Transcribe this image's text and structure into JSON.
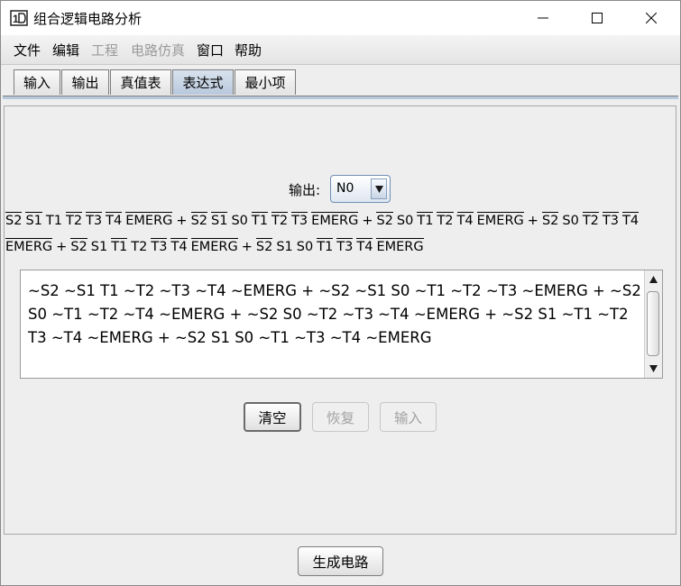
{
  "window": {
    "title": "组合逻辑电路分析"
  },
  "menu": [
    {
      "label": "文件",
      "enabled": true
    },
    {
      "label": "编辑",
      "enabled": true
    },
    {
      "label": "工程",
      "enabled": false
    },
    {
      "label": "电路仿真",
      "enabled": false
    },
    {
      "label": "窗口",
      "enabled": true
    },
    {
      "label": "帮助",
      "enabled": true
    }
  ],
  "tabs": [
    {
      "label": "输入",
      "active": false
    },
    {
      "label": "输出",
      "active": false
    },
    {
      "label": "真值表",
      "active": false
    },
    {
      "label": "表达式",
      "active": true
    },
    {
      "label": "最小项",
      "active": false
    }
  ],
  "output": {
    "label": "输出:",
    "selected": "N0"
  },
  "expression_lines": [
    [
      {
        "t": "S2",
        "n": true
      },
      {
        "t": "S1",
        "n": true
      },
      {
        "t": "T1",
        "n": false
      },
      {
        "t": "T2",
        "n": true
      },
      {
        "t": "T3",
        "n": true
      },
      {
        "t": "T4",
        "n": true
      },
      {
        "t": "EMERG",
        "n": true
      },
      {
        "t": "+",
        "n": false
      },
      {
        "t": "S2",
        "n": true
      },
      {
        "t": "S1",
        "n": true
      },
      {
        "t": "S0",
        "n": false
      },
      {
        "t": "T1",
        "n": true
      },
      {
        "t": "T2",
        "n": true
      },
      {
        "t": "T3",
        "n": true
      },
      {
        "t": "EMERG",
        "n": true
      },
      {
        "t": "+",
        "n": false
      },
      {
        "t": "S2",
        "n": true
      },
      {
        "t": "S0",
        "n": false
      },
      {
        "t": "T1",
        "n": true
      },
      {
        "t": "T2",
        "n": true
      },
      {
        "t": "T4",
        "n": true
      },
      {
        "t": "EMERG",
        "n": true
      },
      {
        "t": "+",
        "n": false
      },
      {
        "t": "S2",
        "n": true
      },
      {
        "t": "S0",
        "n": false
      },
      {
        "t": "T2",
        "n": true
      },
      {
        "t": "T3",
        "n": true
      },
      {
        "t": "T4",
        "n": true
      }
    ],
    [
      {
        "t": "EMERG",
        "n": true
      },
      {
        "t": "+",
        "n": false
      },
      {
        "t": "S2",
        "n": true
      },
      {
        "t": "S1",
        "n": false
      },
      {
        "t": "T1",
        "n": true
      },
      {
        "t": "T2",
        "n": false
      },
      {
        "t": "T3",
        "n": true
      },
      {
        "t": "T4",
        "n": true
      },
      {
        "t": "EMERG",
        "n": true
      },
      {
        "t": "+",
        "n": false
      },
      {
        "t": "S2",
        "n": true
      },
      {
        "t": "S1",
        "n": false
      },
      {
        "t": "S0",
        "n": false
      },
      {
        "t": "T1",
        "n": true
      },
      {
        "t": "T3",
        "n": true
      },
      {
        "t": "T4",
        "n": true
      },
      {
        "t": "EMERG",
        "n": true
      }
    ]
  ],
  "editor_lines": [
    "~S2 ~S1 T1 ~T2 ~T3 ~T4 ~EMERG + ~S2 ~S1 S0 ~T1 ~T2 ~T3 ~EMERG + ~S2",
    "S0 ~T1 ~T2 ~T4 ~EMERG + ~S2 S0 ~T2 ~T3 ~T4 ~EMERG + ~S2 S1 ~T1 ~T2",
    "T3 ~T4 ~EMERG + ~S2 S1 S0 ~T1 ~T3 ~T4 ~EMERG"
  ],
  "buttons": {
    "clear": "清空",
    "restore": "恢复",
    "enter": "输入",
    "generate": "生成电路"
  }
}
